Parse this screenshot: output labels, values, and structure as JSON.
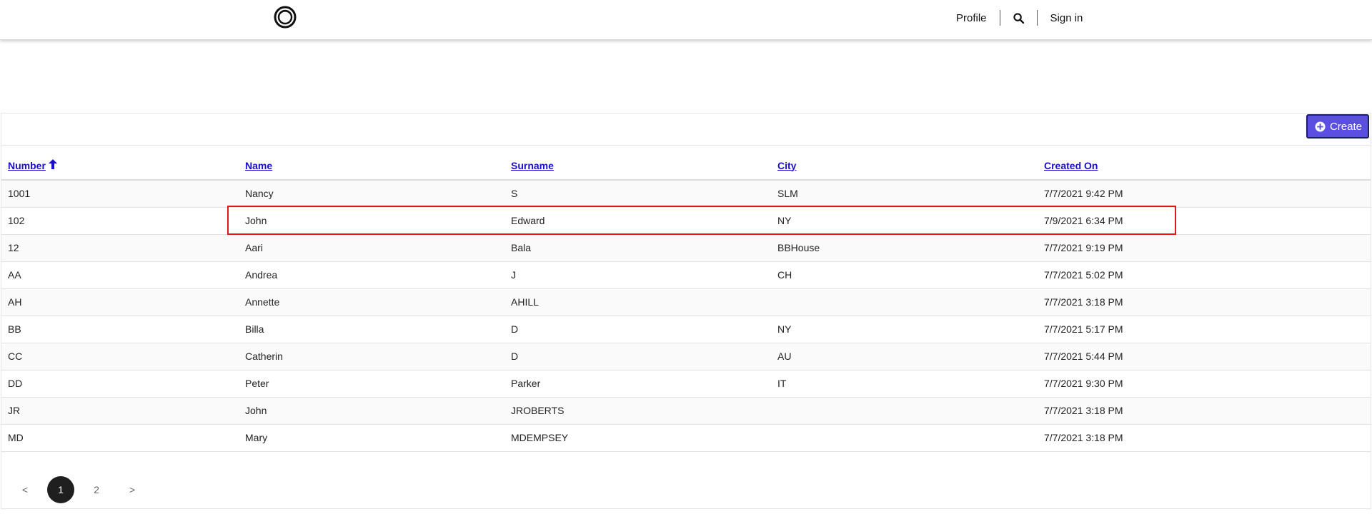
{
  "header": {
    "logo_icon": "ring-logo-icon",
    "nav": {
      "profile": "Profile",
      "search_icon": "search-icon",
      "sign_in": "Sign in"
    }
  },
  "toolbar": {
    "create_label": "Create",
    "create_icon": "plus-circle-icon",
    "accent_color": "#5a4fe0"
  },
  "table": {
    "columns": [
      {
        "label": "Number",
        "sort": "ascending"
      },
      {
        "label": "Name"
      },
      {
        "label": "Surname"
      },
      {
        "label": "City"
      },
      {
        "label": "Created On"
      }
    ],
    "rows": [
      [
        "1001",
        "Nancy",
        "S",
        "SLM",
        "7/7/2021 9:42 PM"
      ],
      [
        "102",
        "John",
        "Edward",
        "NY",
        "7/9/2021 6:34 PM"
      ],
      [
        "12",
        "Aari",
        "Bala",
        "BBHouse",
        "7/7/2021 9:19 PM"
      ],
      [
        "AA",
        "Andrea",
        "J",
        "CH",
        "7/7/2021 5:02 PM"
      ],
      [
        "AH",
        "Annette",
        "AHILL",
        "",
        "7/7/2021 3:18 PM"
      ],
      [
        "BB",
        "Billa",
        "D",
        "NY",
        "7/7/2021 5:17 PM"
      ],
      [
        "CC",
        "Catherin",
        "D",
        "AU",
        "7/7/2021 5:44 PM"
      ],
      [
        "DD",
        "Peter",
        "Parker",
        "IT",
        "7/7/2021 9:30 PM"
      ],
      [
        "JR",
        "John",
        "JROBERTS",
        "",
        "7/7/2021 3:18 PM"
      ],
      [
        "MD",
        "Mary",
        "MDEMPSEY",
        "",
        "7/7/2021 3:18 PM"
      ]
    ],
    "highlight_color": "#e01a1a"
  },
  "pagination": {
    "prev": "<",
    "pages": [
      "1",
      "2"
    ],
    "next": ">",
    "current_page": "1"
  }
}
